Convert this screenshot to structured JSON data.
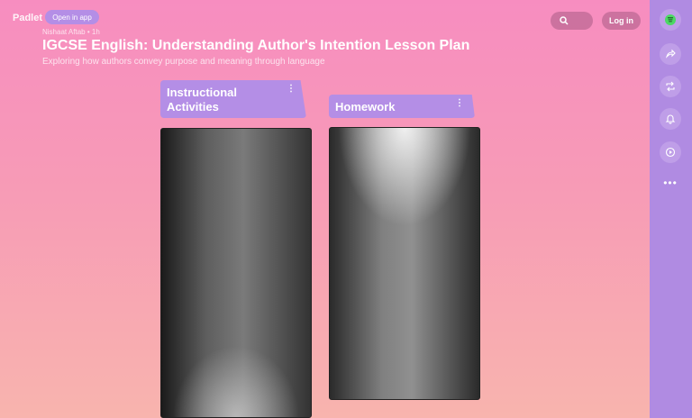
{
  "app": {
    "logo": "Padlet",
    "open_in_app": "Open in app"
  },
  "post_meta": {
    "author": "Nishaat Aftab",
    "separator": "•",
    "age": "1h"
  },
  "board": {
    "title": "IGCSE English: Understanding Author's Intention Lesson Plan",
    "subtitle": "Exploring how authors convey purpose and meaning through language"
  },
  "header": {
    "search_icon": "search-icon",
    "login_label": "Log in"
  },
  "columns": [
    {
      "title": "Instructional Activities",
      "menu_icon": "kebab-icon"
    },
    {
      "title": "Homework",
      "menu_icon": "kebab-icon"
    }
  ],
  "rail": {
    "items": [
      "remake-icon",
      "share-icon",
      "remix-icon",
      "bell-icon",
      "slideshow-icon"
    ],
    "more": "•••"
  },
  "colors": {
    "accent": "#b48ee6",
    "rail": "#b08be2",
    "remake_icon": "#4cd964"
  }
}
